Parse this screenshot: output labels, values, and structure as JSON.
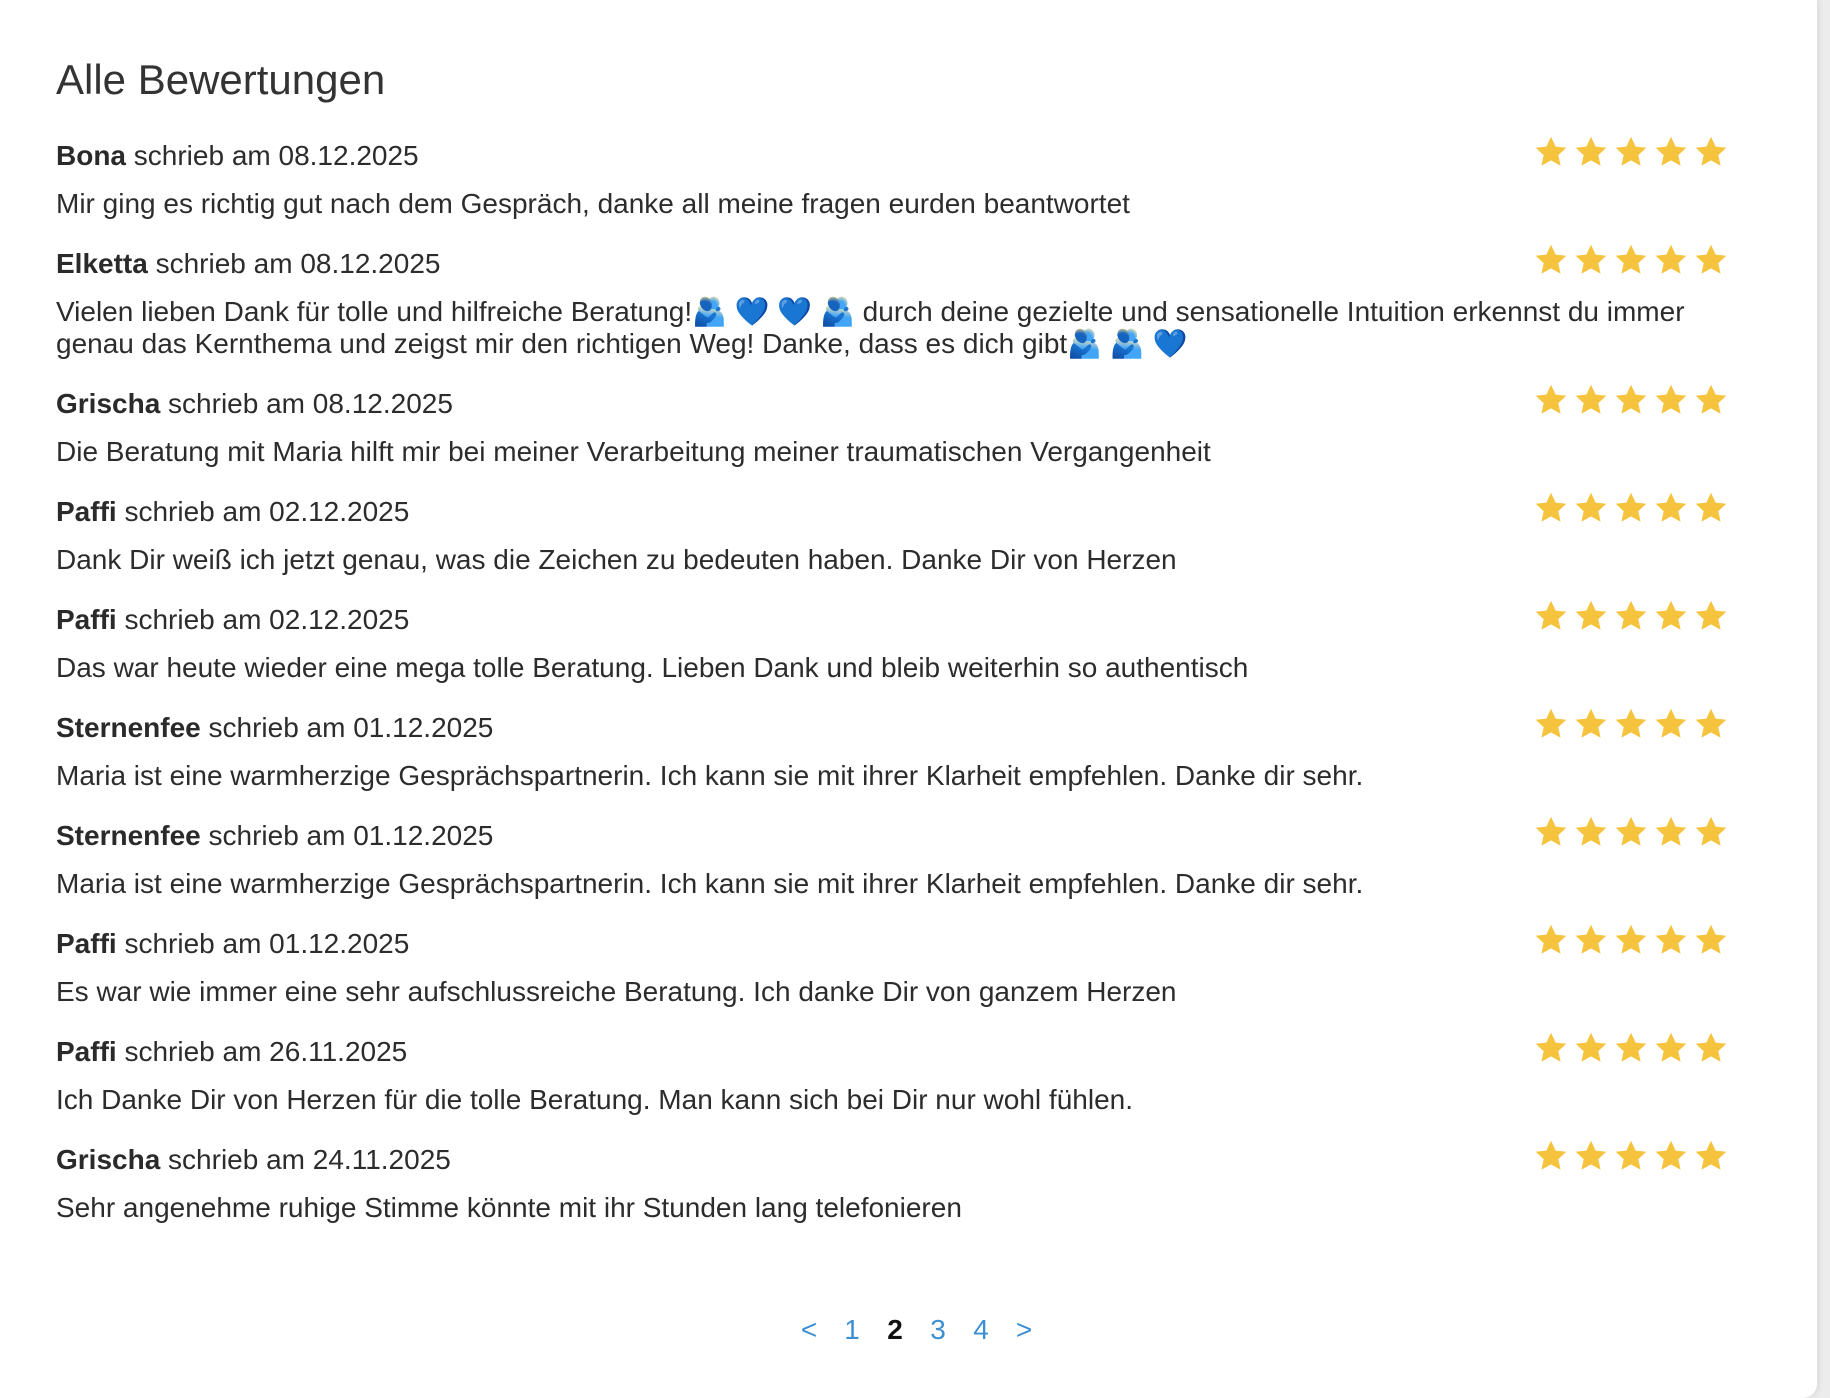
{
  "section": {
    "title": "Alle Bewertungen"
  },
  "reviews": [
    {
      "author": "Bona",
      "meta": " schrieb am 08.12.2025",
      "text": "Mir ging es richtig gut nach dem Gespräch, danke all meine fragen eurden beantwortet",
      "rating": 5
    },
    {
      "author": "Elketta",
      "meta": " schrieb am 08.12.2025",
      "text": "Vielen lieben Dank für tolle und hilfreiche Beratung!🫂 💙 💙 🫂 durch deine gezielte und sensationelle Intuition erkennst du immer genau das Kernthema und zeigst mir den richtigen Weg! Danke, dass es dich gibt🫂 🫂 💙",
      "rating": 5
    },
    {
      "author": "Grischa",
      "meta": " schrieb am 08.12.2025",
      "text": "Die Beratung mit Maria hilft mir bei meiner Verarbeitung meiner traumatischen Vergangenheit",
      "rating": 5
    },
    {
      "author": "Paffi",
      "meta": " schrieb am 02.12.2025",
      "text": "Dank Dir weiß ich jetzt genau, was die Zeichen zu bedeuten haben. Danke Dir von Herzen",
      "rating": 5
    },
    {
      "author": "Paffi",
      "meta": " schrieb am 02.12.2025",
      "text": "Das war heute wieder eine mega tolle Beratung. Lieben Dank und bleib weiterhin so authentisch",
      "rating": 5
    },
    {
      "author": "Sternenfee",
      "meta": " schrieb am 01.12.2025",
      "text": "Maria ist eine warmherzige Gesprächspartnerin. Ich kann sie mit ihrer Klarheit empfehlen. Danke dir sehr.",
      "rating": 5
    },
    {
      "author": "Sternenfee",
      "meta": " schrieb am 01.12.2025",
      "text": "Maria ist eine warmherzige Gesprächspartnerin. Ich kann sie mit ihrer Klarheit empfehlen. Danke dir sehr.",
      "rating": 5
    },
    {
      "author": "Paffi",
      "meta": " schrieb am 01.12.2025",
      "text": "Es war wie immer eine sehr aufschlussreiche Beratung. Ich danke Dir von ganzem Herzen",
      "rating": 5
    },
    {
      "author": "Paffi",
      "meta": " schrieb am 26.11.2025",
      "text": "Ich Danke Dir von Herzen für die tolle Beratung. Man kann sich bei Dir nur wohl fühlen.",
      "rating": 5
    },
    {
      "author": "Grischa",
      "meta": " schrieb am 24.11.2025",
      "text": "Sehr angenehme ruhige Stimme könnte mit ihr Stunden lang telefonieren",
      "rating": 5
    }
  ],
  "pagination": {
    "prev_label": "<",
    "pages": [
      "1",
      "2",
      "3",
      "4"
    ],
    "current": "2",
    "next_label": ">"
  },
  "colors": {
    "star": "#f6c33e",
    "link": "#3d8fd1"
  }
}
